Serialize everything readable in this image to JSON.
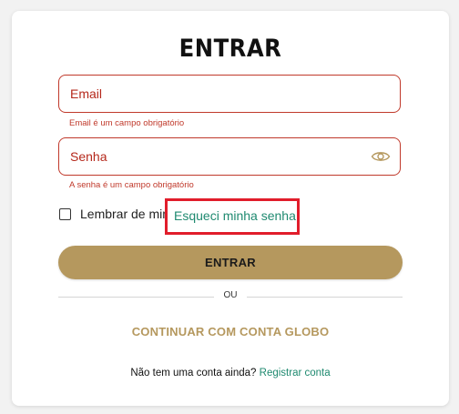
{
  "login": {
    "title": "ENTRAR",
    "email": {
      "placeholder": "Email",
      "value": "",
      "error": "Email é um campo obrigatório"
    },
    "password": {
      "placeholder": "Senha",
      "value": "",
      "error": "A senha é um campo obrigatório",
      "toggle_icon": "eye-icon"
    },
    "remember_label": "Lembrar de mim",
    "remember_checked": false,
    "forgot_label": "Esqueci minha senha",
    "submit_label": "ENTRAR",
    "divider_label": "OU",
    "globo_label": "CONTINUAR COM CONTA GLOBO",
    "signup_prompt": "Não tem uma conta ainda?",
    "signup_link": "Registrar conta"
  },
  "colors": {
    "accent_gold": "#b5985e",
    "error_red": "#c0392b",
    "highlight_red": "#e11d2b",
    "link_green": "#1f8a70"
  }
}
